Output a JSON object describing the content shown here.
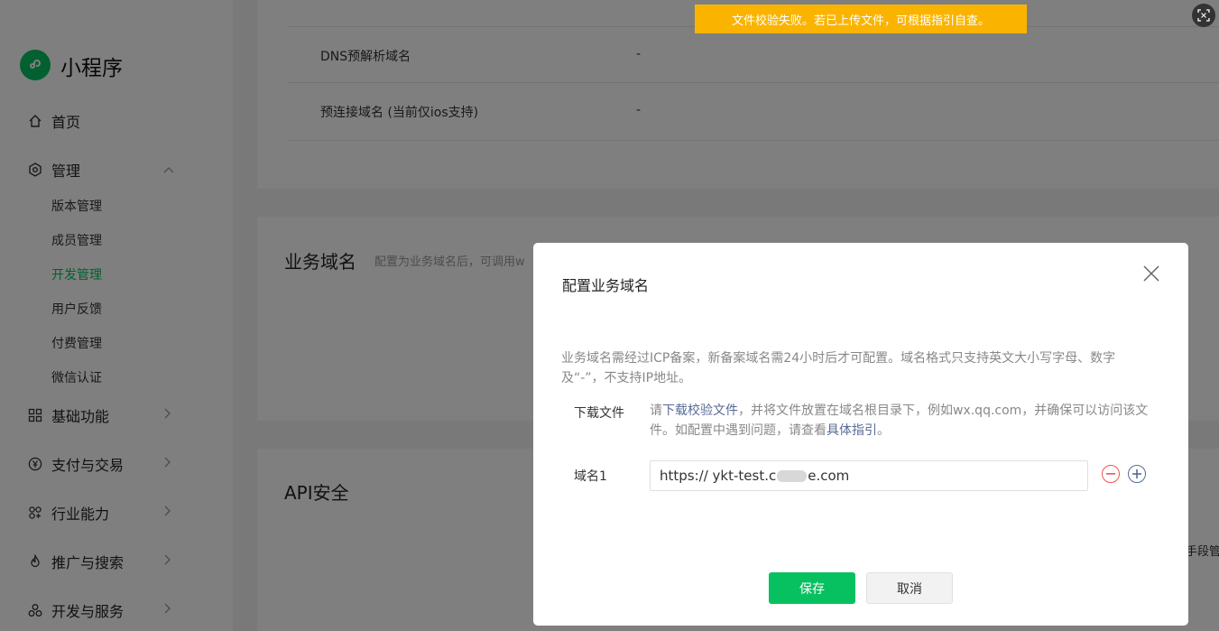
{
  "toast": {
    "text": "文件校验失败。若已上传文件，可根据指引自查。"
  },
  "sidebar": {
    "app_name": "小程序",
    "nav": [
      {
        "label": "首页",
        "icon": "home-icon"
      },
      {
        "label": "管理",
        "icon": "settings-icon"
      },
      {
        "label": "基础功能",
        "icon": "grid-icon"
      },
      {
        "label": "支付与交易",
        "icon": "yuan-icon"
      },
      {
        "label": "行业能力",
        "icon": "industry-icon"
      },
      {
        "label": "推广与搜索",
        "icon": "flame-icon"
      },
      {
        "label": "开发与服务",
        "icon": "dev-service-icon"
      }
    ],
    "management_items": [
      "版本管理",
      "成员管理",
      "开发管理",
      "用户反馈",
      "付费管理",
      "微信认证"
    ],
    "active_item": "开发管理"
  },
  "main": {
    "server_rows": [
      {
        "label": "DNS预解析域名",
        "value": "-"
      },
      {
        "label": "预连接域名 (当前仅ios支持)",
        "value": "-"
      }
    ],
    "business_domain": {
      "title": "业务域名",
      "desc": "配置为业务域名后，可调用w"
    },
    "api_security": {
      "title": "API安全",
      "right_snippet": "手段管"
    }
  },
  "modal": {
    "title": "配置业务域名",
    "description": "业务域名需经过ICP备案，新备案域名需24小时后才可配置。域名格式只支持英文大小写字母、数字及“-”，不支持IP地址。",
    "download_label": "下载文件",
    "download_text_1": "请",
    "download_link": "下载校验文件",
    "download_text_2": "，并将文件放置在域名根目录下，例如wx.qq.com，并确保可以访问该文件。如配置中遇到问题，请查看",
    "guide_link": "具体指引",
    "download_text_3": "。",
    "domain_label": "域名1",
    "domain_value": "https:// ykt-test.c",
    "domain_value_tail": "e.com",
    "save_label": "保存",
    "cancel_label": "取消"
  },
  "colors": {
    "accent": "#07c160",
    "toast": "#fab400",
    "link": "#576b95",
    "danger": "#fa5151"
  }
}
